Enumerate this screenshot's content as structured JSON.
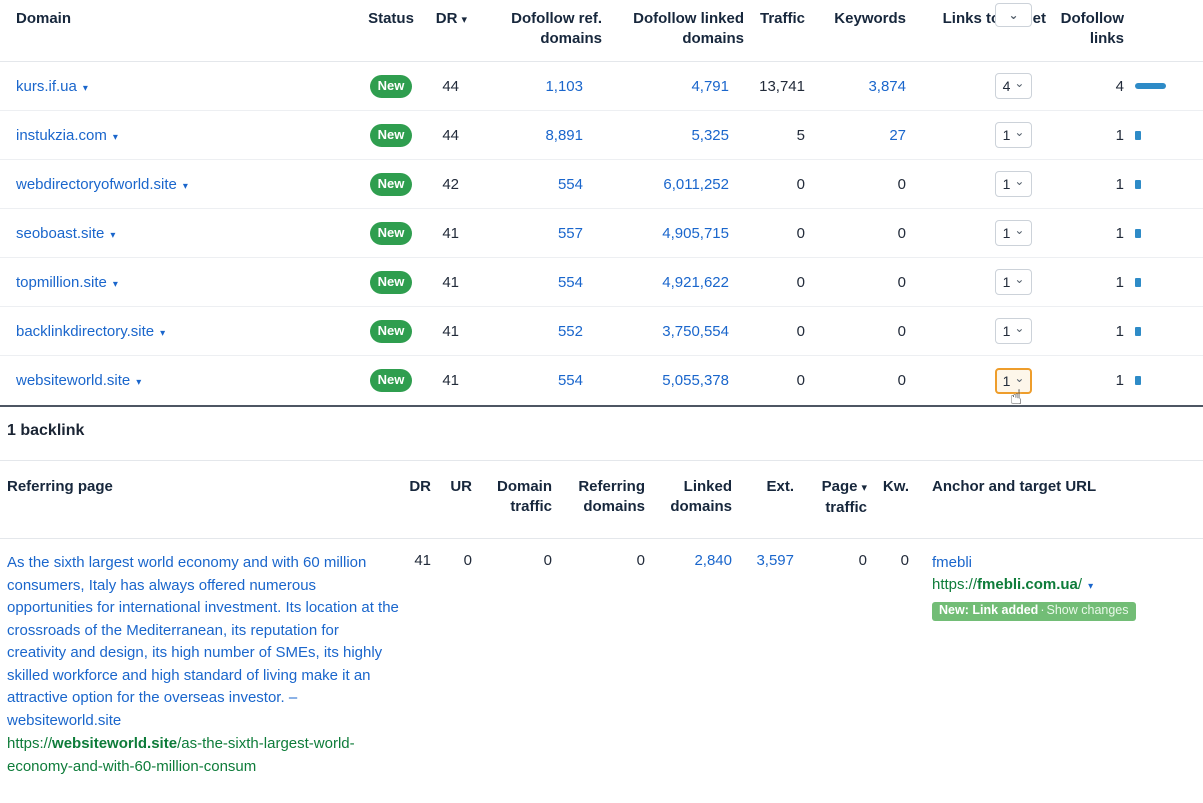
{
  "colors": {
    "link_blue": "#1a66cc",
    "url_green": "#0e7c3a",
    "status_badge_green": "#2f9e4f",
    "change_badge_green": "#72bd76",
    "bar_blue": "#2e8bc7",
    "highlight_orange": "#ee9d2b"
  },
  "table1": {
    "headers": {
      "domain": "Domain",
      "status": "Status",
      "dr": "DR",
      "dofollow_ref": "Dofollow ref. domains",
      "dofollow_linked": "Dofollow linked domains",
      "traffic": "Traffic",
      "keywords": "Keywords",
      "links_to_target": "Links to target",
      "dofollow_links": "Dofollow links"
    },
    "rows": [
      {
        "domain": "kurs.if.ua",
        "status": "New",
        "dr": "44",
        "ref": "1,103",
        "linked": "4,791",
        "traffic": "13,741",
        "keywords": "3,874",
        "select": "4",
        "links": "4"
      },
      {
        "domain": "instukzia.com",
        "status": "New",
        "dr": "44",
        "ref": "8,891",
        "linked": "5,325",
        "traffic": "5",
        "keywords": "27",
        "select": "1",
        "links": "1"
      },
      {
        "domain": "webdirectoryofworld.site",
        "status": "New",
        "dr": "42",
        "ref": "554",
        "linked": "6,011,252",
        "traffic": "0",
        "keywords": "0",
        "select": "1",
        "links": "1"
      },
      {
        "domain": "seoboast.site",
        "status": "New",
        "dr": "41",
        "ref": "557",
        "linked": "4,905,715",
        "traffic": "0",
        "keywords": "0",
        "select": "1",
        "links": "1"
      },
      {
        "domain": "topmillion.site",
        "status": "New",
        "dr": "41",
        "ref": "554",
        "linked": "4,921,622",
        "traffic": "0",
        "keywords": "0",
        "select": "1",
        "links": "1"
      },
      {
        "domain": "backlinkdirectory.site",
        "status": "New",
        "dr": "41",
        "ref": "552",
        "linked": "3,750,554",
        "traffic": "0",
        "keywords": "0",
        "select": "1",
        "links": "1"
      },
      {
        "domain": "websiteworld.site",
        "status": "New",
        "dr": "41",
        "ref": "554",
        "linked": "5,055,378",
        "traffic": "0",
        "keywords": "0",
        "select": "1",
        "links": "1"
      }
    ]
  },
  "section": {
    "title": "1 backlink"
  },
  "table2": {
    "headers": {
      "referring_page": "Referring page",
      "dr": "DR",
      "ur": "UR",
      "domain_traffic": "Domain traffic",
      "referring_domains": "Referring domains",
      "linked_domains": "Linked domains",
      "ext": "Ext.",
      "page": "Page",
      "page_traffic_line2": "traffic",
      "kw": "Kw.",
      "anchor_target": "Anchor and target URL"
    },
    "row": {
      "title": "As the sixth largest world economy and with 60 million consumers, Italy has always offered numerous opportunities for international investment. Its location at the crossroads of the Mediterranean, its reputation for creativity and design, its high number of SMEs, its highly skilled workforce and high standard of living make it an attractive option for the overseas investor. – websiteworld.site",
      "url_scheme": "https://",
      "url_domain": "websiteworld.site",
      "url_path": "/as-the-sixth-largest-world-economy-and-with-60-million-consum",
      "dr": "41",
      "ur": "0",
      "domain_traffic": "0",
      "referring_domains": "0",
      "linked_domains": "2,840",
      "ext": "3,597",
      "page_traffic": "0",
      "kw": "0",
      "anchor": "fmebli",
      "target_scheme": "https://",
      "target_domain": "fmebli.com.ua",
      "target_path": "/",
      "badge_label": "New: Link added",
      "badge_sep": "·",
      "badge_action": "Show changes"
    }
  }
}
